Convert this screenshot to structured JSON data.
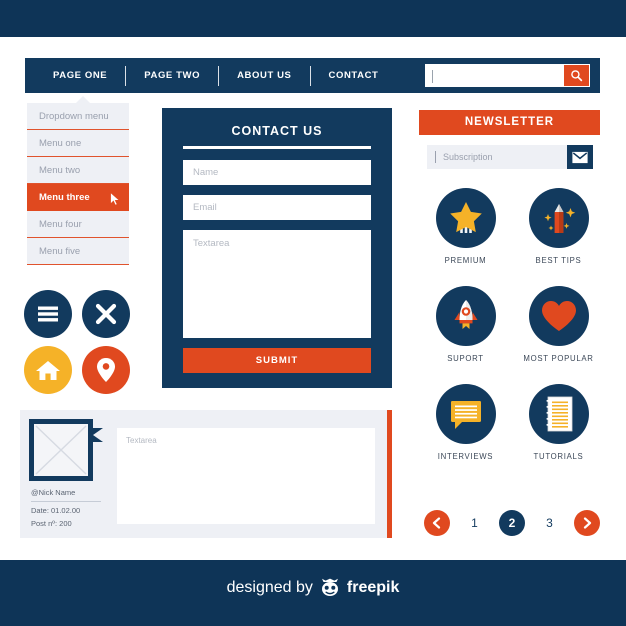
{
  "theme": {
    "navy": "#0e3457",
    "navy_panel": "#123a5e",
    "orange": "#e0491f",
    "yellow": "#f5b228",
    "light_gray": "#eef0f5",
    "muted_text": "#9aa0ae"
  },
  "navbar": {
    "items": [
      {
        "label": "PAGE ONE"
      },
      {
        "label": "PAGE TWO"
      },
      {
        "label": "ABOUT US"
      },
      {
        "label": "CONTACT"
      }
    ],
    "search": {
      "value": "",
      "placeholder": "",
      "icon": "search-icon"
    }
  },
  "dropdown": {
    "items": [
      {
        "label": "Dropdown menu",
        "active": false
      },
      {
        "label": "Menu one",
        "active": false
      },
      {
        "label": "Menu two",
        "active": false
      },
      {
        "label": "Menu three",
        "active": true
      },
      {
        "label": "Menu four",
        "active": false
      },
      {
        "label": "Menu five",
        "active": false
      }
    ]
  },
  "round_buttons": [
    {
      "icon": "hamburger-menu-icon",
      "color": "#123a5e"
    },
    {
      "icon": "close-x-icon",
      "color": "#123a5e"
    },
    {
      "icon": "home-icon",
      "color": "#f5b228"
    },
    {
      "icon": "location-pin-icon",
      "color": "#e0491f"
    }
  ],
  "contact_form": {
    "title": "CONTACT US",
    "name_placeholder": "Name",
    "email_placeholder": "Email",
    "textarea_placeholder": "Textarea",
    "submit_label": "SUBMIT"
  },
  "newsletter": {
    "title": "NEWSLETTER",
    "subscription_placeholder": "Subscription",
    "submit_icon": "envelope-icon"
  },
  "features": [
    {
      "label": "PREMIUM",
      "icon": "star-badge-icon"
    },
    {
      "label": "BEST TIPS",
      "icon": "pencil-sparkle-icon"
    },
    {
      "label": "SUPORT",
      "icon": "rocket-icon"
    },
    {
      "label": "MOST POPULAR",
      "icon": "heart-icon"
    },
    {
      "label": "INTERVIEWS",
      "icon": "speech-bubble-icon"
    },
    {
      "label": "TUTORIALS",
      "icon": "notebook-icon"
    }
  ],
  "pagination": {
    "prev_icon": "chevron-left-icon",
    "next_icon": "chevron-right-icon",
    "pages": [
      {
        "label": "1",
        "current": false
      },
      {
        "label": "2",
        "current": true
      },
      {
        "label": "3",
        "current": false
      }
    ]
  },
  "comment_card": {
    "avatar_icon": "image-placeholder-icon",
    "nickname": "@Nick Name",
    "date": "Date: 01.02.00",
    "post_number": "Post nº: 200",
    "textarea_placeholder": "Textarea"
  },
  "footer": {
    "designed_by": "designed by",
    "brand": "freepik",
    "logo_icon": "freepik-face-icon"
  }
}
